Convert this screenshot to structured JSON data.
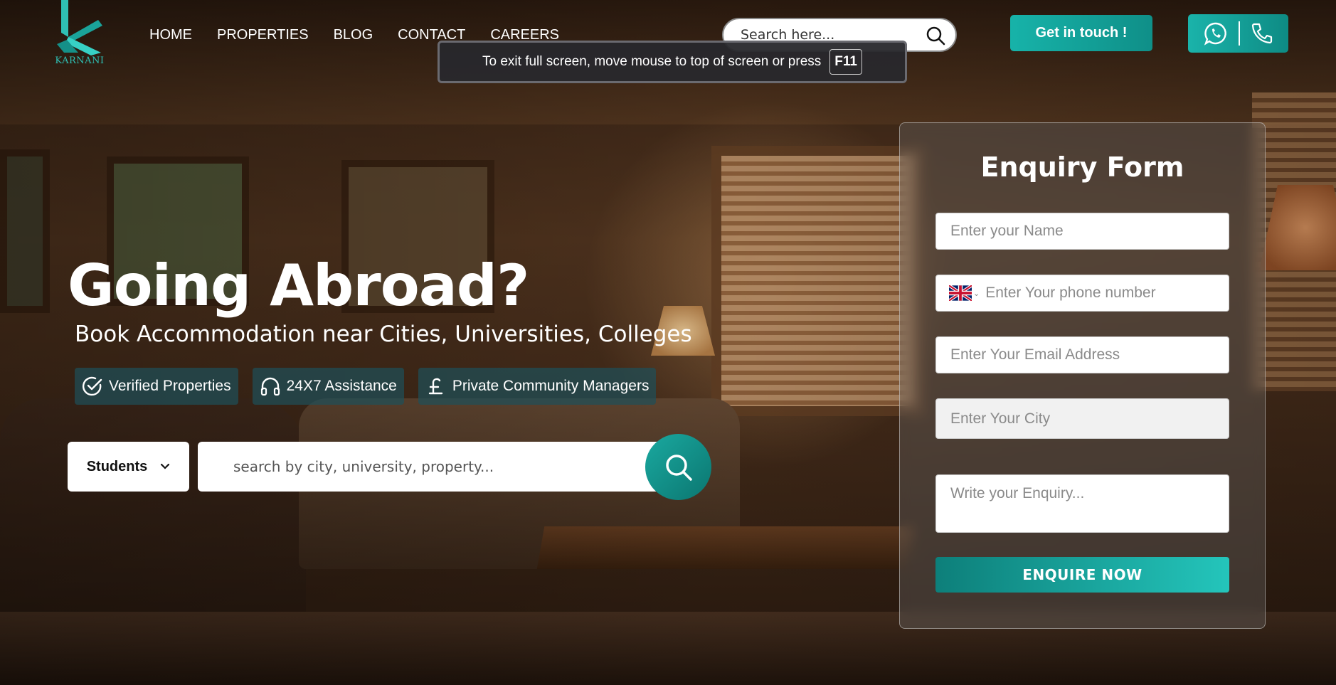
{
  "brand": {
    "logo_text": "KARNANI",
    "accent": "#17b3a9"
  },
  "nav": {
    "items": [
      {
        "label": "HOME"
      },
      {
        "label": "PROPERTIES"
      },
      {
        "label": "BLOG"
      },
      {
        "label": "CONTACT"
      },
      {
        "label": "CAREERS"
      }
    ]
  },
  "header": {
    "search_placeholder": "Search here...",
    "cta_label": "Get in touch !",
    "contact_icons": [
      "whatsapp-icon",
      "phone-icon"
    ]
  },
  "fullscreen_notice": {
    "message": "To exit full screen, move mouse to top of screen or press",
    "key": "F11"
  },
  "hero": {
    "title": "Going Abroad?",
    "subtitle": "Book Accommodation near Cities, Universities, Colleges",
    "features": [
      {
        "icon": "check-circle-icon",
        "label": "Verified Properties"
      },
      {
        "icon": "headphones-icon",
        "label": "24X7 Assistance"
      },
      {
        "icon": "pound-icon",
        "label": "Private Community Managers"
      }
    ],
    "audience_select": {
      "selected": "Students"
    },
    "search_placeholder": "search by city, university, property..."
  },
  "enquiry_form": {
    "title": "Enquiry Form",
    "name_placeholder": "Enter your Name",
    "phone_placeholder": "Enter Your phone number",
    "email_placeholder": "Enter Your Email Address",
    "city_placeholder": "Enter Your City",
    "message_placeholder": "Write your Enquiry...",
    "submit_label": "ENQUIRE NOW"
  }
}
